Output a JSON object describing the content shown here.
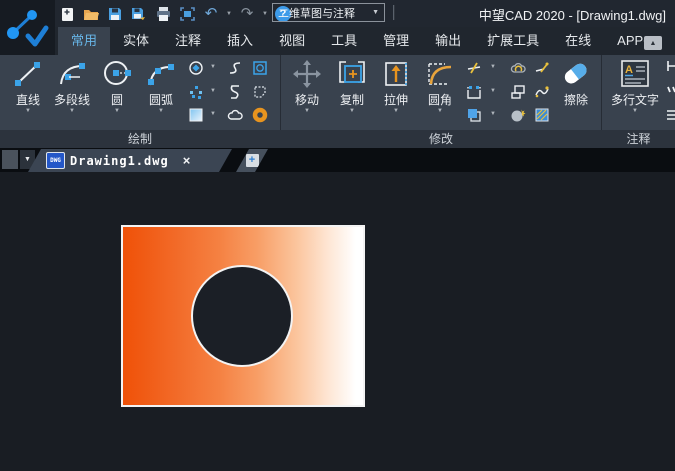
{
  "colors": {
    "accent_blue": "#3ba3e8",
    "ribbon_bg": "#39424e",
    "titlebar_bg": "#212730",
    "canvas_bg": "#191d23",
    "gradient_start": "#ef5108",
    "gradient_end": "#ffffff",
    "entity_outline": "#f3f3f3"
  },
  "glyphs": {
    "caret": "▼",
    "caret_small": "▼",
    "collapse": "▲",
    "close": "×",
    "undo": "↶",
    "redo": "↷",
    "help": "?",
    "plus": "+",
    "dropdown": "▼"
  },
  "titlebar": {
    "title": "中望CAD 2020 - [Drawing1.dwg]",
    "workspace": "二维草图与注释"
  },
  "tabs": {
    "home": "常用",
    "solid": "实体",
    "annotate": "注释",
    "insert": "插入",
    "view": "视图",
    "tools": "工具",
    "manage": "管理",
    "output": "输出",
    "express": "扩展工具",
    "online": "在线",
    "app": "APP+"
  },
  "ribbon": {
    "draw": {
      "label": "绘制",
      "line": "直线",
      "polyline": "多段线",
      "circle": "圆",
      "arc": "圆弧"
    },
    "modify": {
      "label": "修改",
      "move": "移动",
      "copy": "复制",
      "stretch": "拉伸",
      "fillet": "圆角",
      "erase": "擦除"
    },
    "annotation": {
      "label": "注释",
      "mtext": "多行文字"
    }
  },
  "doctab": {
    "filename": "Drawing1.dwg",
    "badge": "DWG"
  }
}
